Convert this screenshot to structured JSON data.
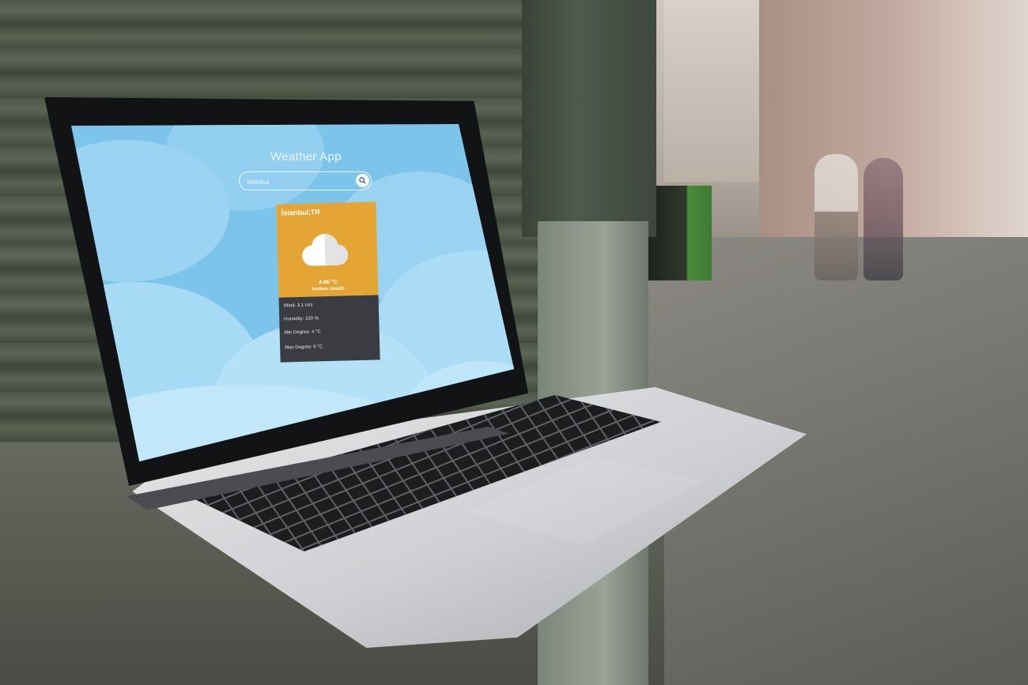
{
  "app": {
    "title": "Weather App"
  },
  "search": {
    "value": "istanbul",
    "icon": "search-icon"
  },
  "weather_card": {
    "location": "İstanbul,TR",
    "icon": "cloud-icon",
    "temperature": "4.86 °C",
    "description": "broken clouds",
    "wind": "Wind: 3.1 m/s",
    "humidity": "Humidity: 100 %",
    "min_degree": "Min Degree: 4 °C",
    "max_degree": "Max Degree: 6 °C",
    "colors": {
      "card_top": "#e4a535",
      "card_bottom": "#3a3c41",
      "sky": "#7cc4ea"
    }
  }
}
